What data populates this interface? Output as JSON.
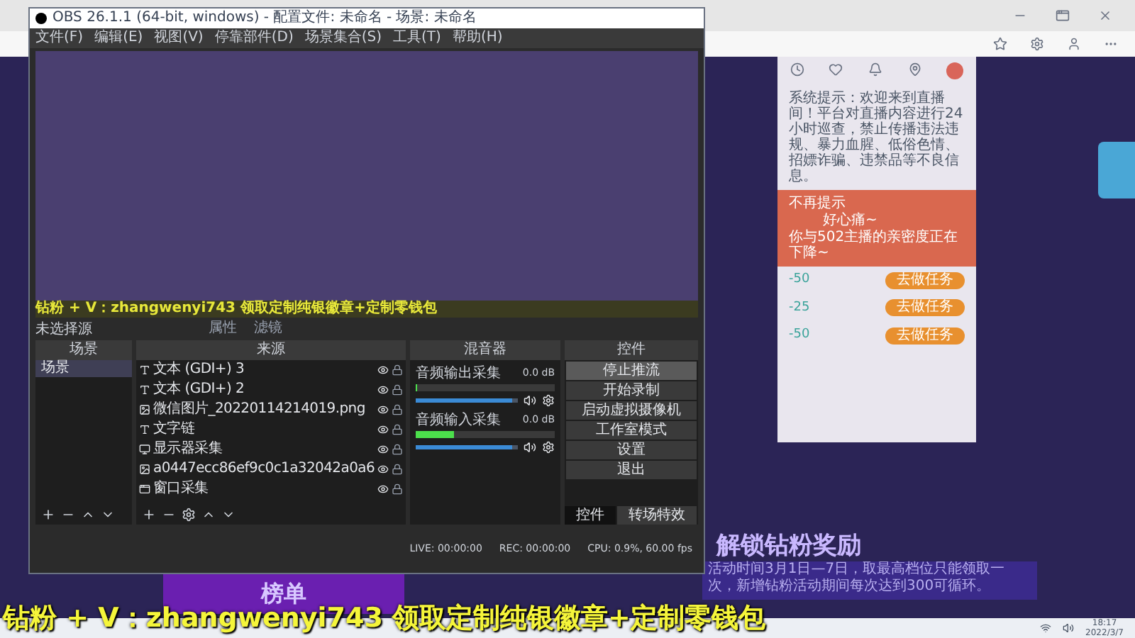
{
  "obs": {
    "title": "OBS 26.1.1 (64-bit, windows) - 配置文件: 未命名 - 场景: 未命名",
    "menu": [
      "文件(F)",
      "编辑(E)",
      "视图(V)",
      "停靠部件(D)",
      "场景集合(S)",
      "工具(T)",
      "帮助(H)"
    ],
    "preview_banner": "钻粉 + V：zhangwenyi743 领取定制纯银徽章+定制零钱包",
    "source_bar": {
      "label": "未选择源",
      "buttons": [
        "属性",
        "滤镜"
      ]
    },
    "scenes": {
      "title": "场景",
      "items": [
        {
          "label": "场景",
          "selected": true
        }
      ]
    },
    "sources": {
      "title": "来源",
      "items": [
        {
          "kind": "text",
          "label": "文本 (GDI+) 3",
          "visible": true
        },
        {
          "kind": "text",
          "label": "文本 (GDI+) 2",
          "visible": true
        },
        {
          "kind": "image",
          "label": "微信图片_20220114214019.png",
          "visible": true
        },
        {
          "kind": "text",
          "label": "文字链",
          "visible": true
        },
        {
          "kind": "display",
          "label": "显示器采集",
          "visible": true
        },
        {
          "kind": "image",
          "label": "a0447ecc86ef9c0c1a32042a0a6",
          "visible": true
        },
        {
          "kind": "window",
          "label": "窗口采集",
          "visible": true
        }
      ]
    },
    "mixer": {
      "title": "混音器",
      "channels": [
        {
          "name": "音频输出采集",
          "reading": "0.0 dB",
          "meter": {
            "level": 0.0
          },
          "volume": {
            "level": 0.95
          }
        },
        {
          "name": "音频输入采集",
          "reading": "0.0 dB",
          "meter": {
            "level": 0.28
          },
          "volume": {
            "level": 0.95
          }
        }
      ]
    },
    "controls": {
      "title": "控件",
      "buttons": [
        {
          "label": "停止推流",
          "selected": true
        },
        {
          "label": "开始录制",
          "selected": false
        },
        {
          "label": "启动虚拟摄像机",
          "selected": false
        },
        {
          "label": "工作室模式",
          "selected": false
        },
        {
          "label": "设置",
          "selected": false
        },
        {
          "label": "退出",
          "selected": false
        }
      ],
      "tabs": [
        {
          "label": "控件",
          "selected": true
        },
        {
          "label": "转场特效",
          "selected": false
        }
      ]
    },
    "status": [
      "LIVE: 00:00:00",
      "REC: 00:00:00",
      "CPU: 0.9%, 60.00 fps"
    ]
  },
  "page": {
    "chat": {
      "system_message": "系统提示：欢迎来到直播间！平台对直播内容进行24小时巡查，禁止传播违法违规、暴力血腥、低俗色情、招嫖诈骗、违禁品等不良信息。",
      "popup": {
        "dismiss": "不再提示",
        "title": "好心痛~",
        "message": "你与502主播的亲密度正在下降~"
      },
      "tasks": [
        {
          "badge": "-50",
          "button": "去做任务"
        },
        {
          "badge": "-25",
          "button": "去做任务"
        },
        {
          "badge": "-50",
          "button": "去做任务"
        }
      ]
    },
    "reward_heading": "解锁钻粉奖励",
    "ranking_heading": "榜单",
    "activity_text": "活动时间3月1日—7日，取最高档位只能领取一次，新增钻粉活动期间每次达到300可循环。"
  },
  "banner": "钻粉 + V：zhangwenyi743 领取定制纯银徽章+定制零钱包",
  "taskbar": {
    "time": "18:17",
    "date": "2022/3/7"
  }
}
